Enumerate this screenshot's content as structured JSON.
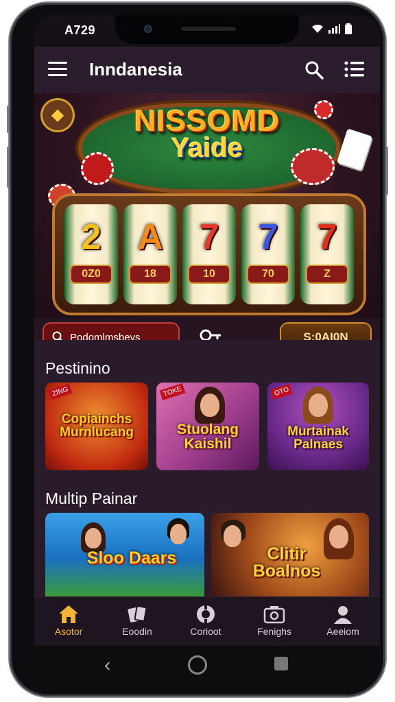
{
  "status_bar": {
    "time": "A729"
  },
  "app_bar": {
    "title": "Inndanesia"
  },
  "banner": {
    "title_line1": "NISSOMD",
    "title_line2": "Yaide",
    "reels": [
      {
        "symbol": "2",
        "color": "#f4c21a",
        "badge": "0Z0",
        "badge2": ""
      },
      {
        "symbol": "A",
        "color": "#f38a1a",
        "badge": "18",
        "badge2": ""
      },
      {
        "symbol": "7",
        "color": "#e53a2a",
        "badge": "10",
        "badge2": ""
      },
      {
        "symbol": "7",
        "color": "#3a56e0",
        "badge": "70",
        "badge2": ""
      },
      {
        "symbol": "7",
        "color": "#e0301a",
        "badge": "Z",
        "badge2": ""
      }
    ],
    "search_pill": "Podomlmsbeys",
    "cta_pill": "S:0AI0N"
  },
  "section1": {
    "title": "Pestinino",
    "cards": [
      {
        "text": "Copiainchs Murnlucang",
        "tag": "ZING",
        "bg": "#d0401a"
      },
      {
        "text": "Stuolang Kaishil",
        "tag": "TOKE",
        "bg": "#b04a98"
      },
      {
        "text": "Murtainak Palnaes",
        "tag": "OTO",
        "bg": "#6a2a8a"
      }
    ]
  },
  "section2": {
    "title": "Multip Painar",
    "cards": [
      {
        "text": "Sloo Daars",
        "bg": "#2a8ad8"
      },
      {
        "text": "Clitir Boalnos",
        "bg": "#8a3a1a"
      }
    ]
  },
  "bottom_nav": [
    {
      "label": "Asotor",
      "icon": "home-icon",
      "active": true
    },
    {
      "label": "Eoodin",
      "icon": "cards-icon",
      "active": false
    },
    {
      "label": "Corioot",
      "icon": "chip-icon",
      "active": false
    },
    {
      "label": "Fenighs",
      "icon": "camera-icon",
      "active": false
    },
    {
      "label": "Aeeiom",
      "icon": "profile-icon",
      "active": false
    }
  ],
  "colors": {
    "accent": "#f2b33a",
    "background": "#2a1b2b",
    "nav_bg": "#1f1520"
  }
}
